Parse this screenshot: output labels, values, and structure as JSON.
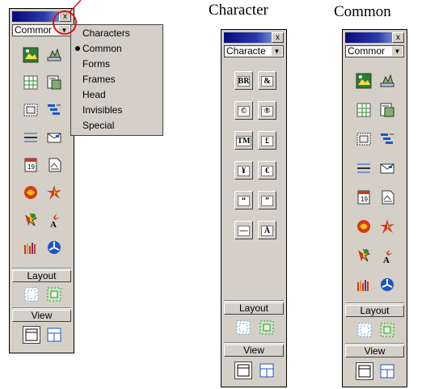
{
  "captions": {
    "character": "Character",
    "common": "Common"
  },
  "close_glyph": "x",
  "panel1": {
    "dropdown_value": "Commor",
    "menu_items": [
      "Characters",
      "Common",
      "Forms",
      "Frames",
      "Head",
      "Invisibles",
      "Special"
    ],
    "selected_item": "Common",
    "layout_label": "Layout",
    "view_label": "View"
  },
  "panel2": {
    "dropdown_value": "Characte",
    "buttons": [
      {
        "name": "line-break-icon",
        "glyph": "BR"
      },
      {
        "name": "nonbreaking-space-icon",
        "glyph": "&"
      },
      {
        "name": "copyright-icon",
        "glyph": "©"
      },
      {
        "name": "registered-icon",
        "glyph": "®"
      },
      {
        "name": "trademark-icon",
        "glyph": "TM"
      },
      {
        "name": "pound-icon",
        "glyph": "£"
      },
      {
        "name": "yen-icon",
        "glyph": "¥"
      },
      {
        "name": "euro-icon",
        "glyph": "€"
      },
      {
        "name": "left-quote-icon",
        "glyph": "“"
      },
      {
        "name": "right-quote-icon",
        "glyph": "”"
      },
      {
        "name": "em-dash-icon",
        "glyph": "—"
      },
      {
        "name": "other-characters-icon",
        "glyph": "Ä"
      }
    ],
    "layout_label": "Layout",
    "view_label": "View"
  },
  "panel3": {
    "dropdown_value": "Commor",
    "layout_label": "Layout",
    "view_label": "View"
  },
  "colors": {
    "panel_bg": "#d4d0c8",
    "title_dark": "#0a0a7a",
    "title_light": "#a6c4ec",
    "callout": "#e01010"
  }
}
